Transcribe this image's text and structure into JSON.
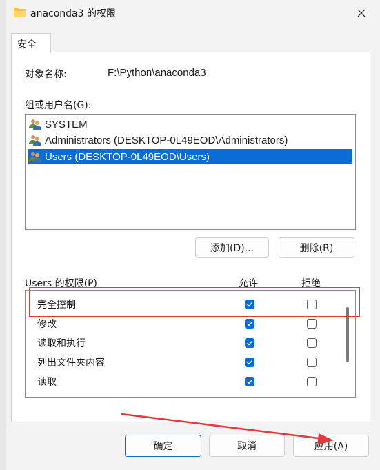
{
  "window": {
    "title": "anaconda3 的权限",
    "close_icon": "close-icon",
    "folder_icon": "folder-icon"
  },
  "tab": {
    "label": "安全"
  },
  "object": {
    "label": "对象名称:",
    "value": "F:\\Python\\anaconda3"
  },
  "groups": {
    "label": "组或用户名(G):",
    "items": [
      {
        "name": "SYSTEM",
        "selected": false
      },
      {
        "name": "Administrators (DESKTOP-0L49EOD\\Administrators)",
        "selected": false
      },
      {
        "name": "Users (DESKTOP-0L49EOD\\Users)",
        "selected": true
      }
    ],
    "add_label": "添加(D)...",
    "remove_label": "删除(R)"
  },
  "permissions": {
    "label": "Users 的权限(P)",
    "allow_header": "允许",
    "deny_header": "拒绝",
    "rows": [
      {
        "name": "完全控制",
        "allow": true,
        "deny": false
      },
      {
        "name": "修改",
        "allow": true,
        "deny": false
      },
      {
        "name": "读取和执行",
        "allow": true,
        "deny": false
      },
      {
        "name": "列出文件夹内容",
        "allow": true,
        "deny": false
      },
      {
        "name": "读取",
        "allow": true,
        "deny": false
      }
    ]
  },
  "footer": {
    "ok_label": "确定",
    "cancel_label": "取消",
    "apply_label": "应用(A)"
  },
  "colors": {
    "accent": "#0a6cd6",
    "annotation": "#e03a3a"
  }
}
